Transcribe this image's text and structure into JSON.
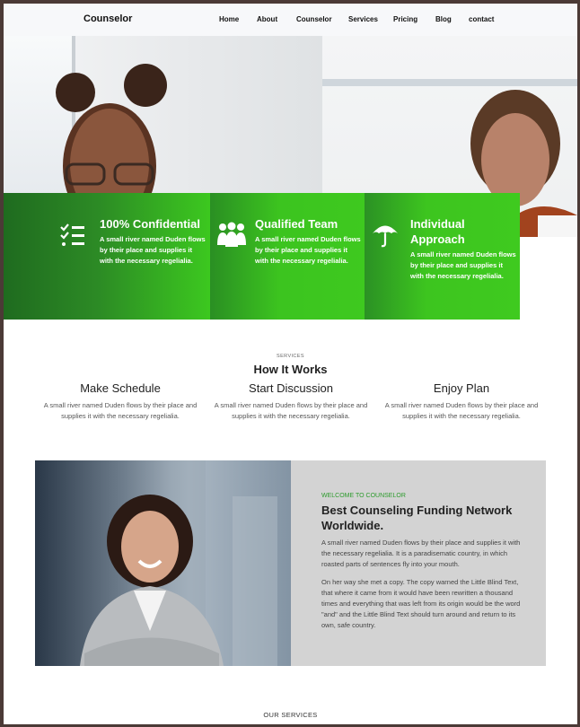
{
  "nav": {
    "brand": "Counselor",
    "items": [
      "Home",
      "About",
      "Counselor",
      "Services",
      "Pricing",
      "Blog",
      "contact"
    ]
  },
  "features": [
    {
      "title": "100% Confidential",
      "text": "A small river named Duden flows by their place and supplies it with the necessary regelialia.",
      "icon": "checklist-icon"
    },
    {
      "title": "Qualified Team",
      "text": "A small river named Duden flows by their place and supplies it with the necessary regelialia.",
      "icon": "team-icon"
    },
    {
      "title_line1": "Individual",
      "title_line2": "Approach",
      "text": "A small river named Duden flows by their place and supplies it with the necessary regelialia.",
      "icon": "umbrella-icon"
    }
  ],
  "how": {
    "kicker": "SERVICES",
    "title": "How It Works",
    "steps": [
      {
        "title": "Make Schedule",
        "text": "A small river named Duden flows by their place and supplies it with the necessary regelialia."
      },
      {
        "title": "Start Discussion",
        "text": "A small river named Duden flows by their place and supplies it with the necessary regelialia."
      },
      {
        "title": "Enjoy Plan",
        "text": "A small river named Duden flows by their place and supplies it with the necessary regelialia."
      }
    ]
  },
  "about": {
    "kicker": "WELCOME TO COUNSELOR",
    "title": "Best Counseling Funding Network Worldwide.",
    "p1": "A small river named Duden flows by their place and supplies it with the necessary regelialia. It is a paradisematic country, in which roasted parts of sentences fly into your mouth.",
    "p2": "On her way she met a copy. The copy warned the Little Blind Text, that where it came from it would have been rewritten a thousand times and everything that was left from its origin would be the word \"and\" and the Little Blind Text should turn around and return to its own, safe country."
  },
  "footer_kicker": "OUR SERVICES",
  "colors": {
    "accent": "#3cc81f",
    "accent_dark": "#1f6b1f",
    "kicker_green": "#2d9b2d"
  }
}
